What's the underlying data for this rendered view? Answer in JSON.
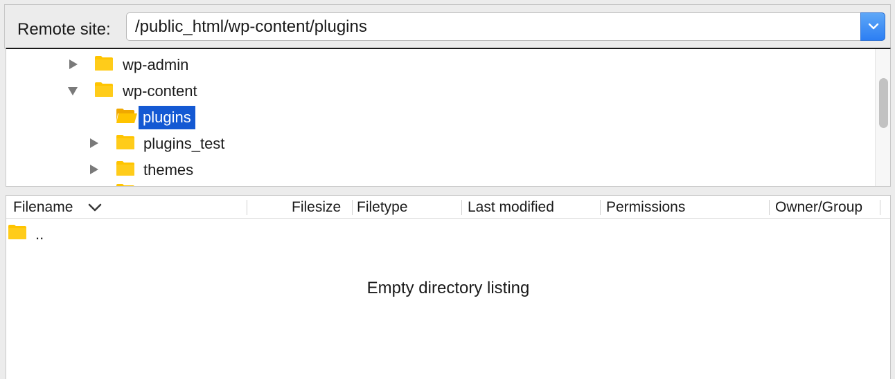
{
  "remote_site": {
    "label": "Remote site:",
    "path": "/public_html/wp-content/plugins"
  },
  "tree": {
    "items": [
      {
        "label": "wp-admin",
        "expanded": false,
        "level": 1
      },
      {
        "label": "wp-content",
        "expanded": true,
        "level": 1
      },
      {
        "label": "plugins",
        "selected": true,
        "level": 2
      },
      {
        "label": "plugins_test",
        "expanded": false,
        "level": 2
      },
      {
        "label": "themes",
        "expanded": false,
        "level": 2
      }
    ]
  },
  "file_list": {
    "columns": [
      "Filename",
      "Filesize",
      "Filetype",
      "Last modified",
      "Permissions",
      "Owner/Group"
    ],
    "rows": [
      {
        "name": ".."
      }
    ],
    "empty_message": "Empty directory listing"
  },
  "colors": {
    "selection": "#1459d3",
    "folder": "#ffc400",
    "combo_button": "#2c7ef3"
  }
}
